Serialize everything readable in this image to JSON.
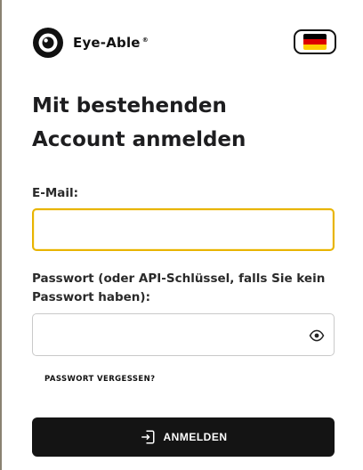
{
  "brand": {
    "name": "Eye-Able",
    "trademark": "®",
    "icon": "eye-logo-icon"
  },
  "language": {
    "selected_flag": "de",
    "flag_colors": [
      "#000000",
      "#dd0000",
      "#ffce00"
    ]
  },
  "heading": {
    "line1": "Mit bestehenden",
    "line2": "Account anmelden"
  },
  "email": {
    "label": "E-Mail:",
    "value": "",
    "placeholder": ""
  },
  "password": {
    "label_line1": "Passwort (oder API-Schlüssel, falls Sie kein",
    "label_line2": "Passwort haben):",
    "value": "",
    "placeholder": "",
    "toggle_icon": "eye-icon"
  },
  "forgot_link": "PASSWORT VERGESSEN?",
  "submit": {
    "label": "ANMELDEN",
    "icon": "login-icon"
  },
  "colors": {
    "accent_focus": "#e8b400",
    "button_bg": "#141414",
    "text": "#1d1d1f"
  }
}
